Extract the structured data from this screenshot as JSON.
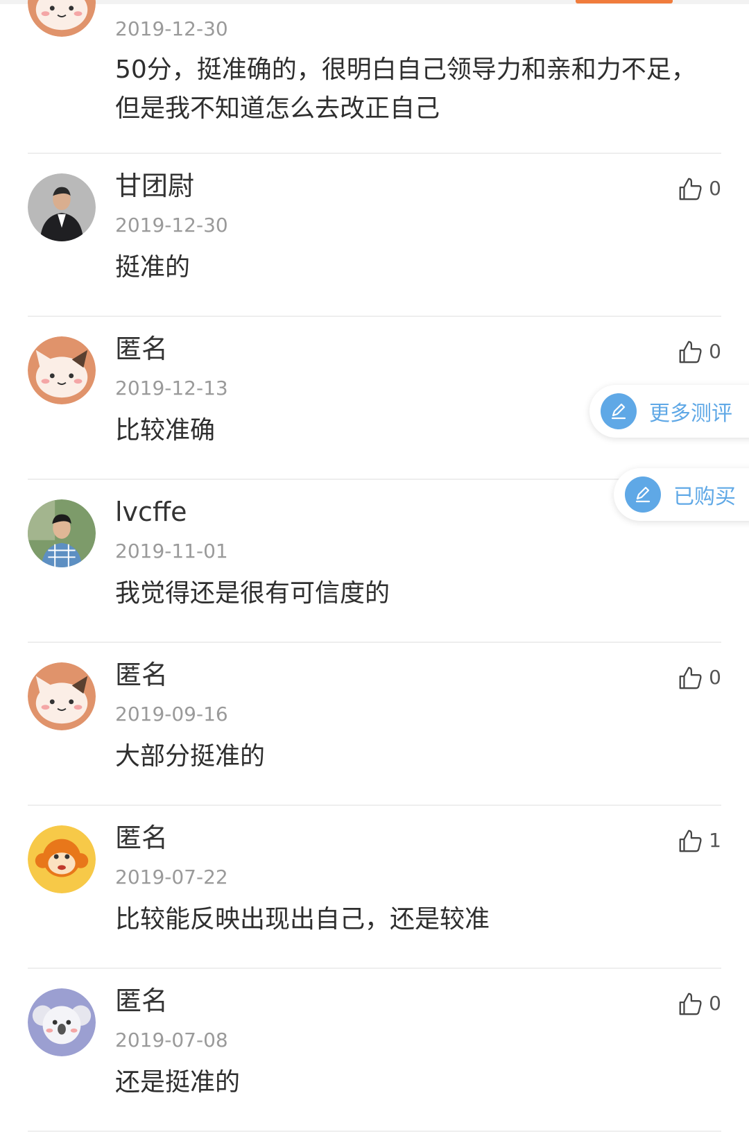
{
  "colors": {
    "accent_orange": "#f07c3c",
    "link_blue": "#5fa8e6",
    "date_gray": "#9a9a9a",
    "divider": "#eeeeee"
  },
  "comments": [
    {
      "name": "",
      "date": "2019-12-30",
      "text": "50分，挺准确的，很明白自己领导力和亲和力不足，但是我不知道怎么去改正自己",
      "avatar": "cat-avatar"
    },
    {
      "name": "甘团尉",
      "date": "2019-12-30",
      "text": "挺准的",
      "likes": "0",
      "avatar": "man-suit-photo"
    },
    {
      "name": "匿名",
      "date": "2019-12-13",
      "text": "比较准确",
      "likes": "0",
      "avatar": "cat-avatar"
    },
    {
      "name": "lvcffe",
      "date": "2019-11-01",
      "text": "我觉得还是很有可信度的",
      "avatar": "man-photo"
    },
    {
      "name": "匿名",
      "date": "2019-09-16",
      "text": "大部分挺准的",
      "likes": "0",
      "avatar": "cat-avatar"
    },
    {
      "name": "匿名",
      "date": "2019-07-22",
      "text": "比较能反映出现出自己，还是较准",
      "likes": "1",
      "avatar": "monkey-avatar"
    },
    {
      "name": "匿名",
      "date": "2019-07-08",
      "text": "还是挺准的",
      "likes": "0",
      "avatar": "koala-avatar"
    }
  ],
  "floating": {
    "more_reviews": "更多测评",
    "purchased": "已购买"
  },
  "icons": {
    "like": "thumb-up-icon",
    "edit": "pencil-icon"
  }
}
